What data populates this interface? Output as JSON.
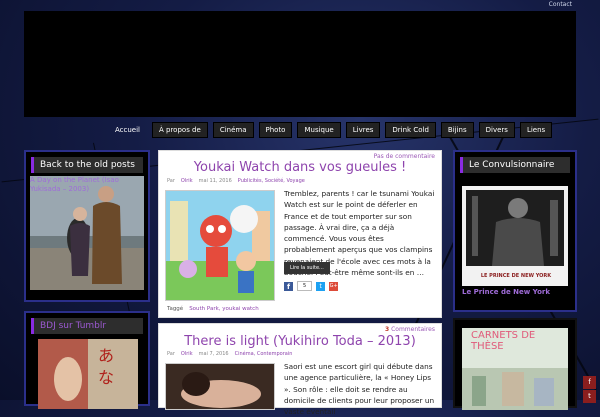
{
  "header": {
    "contact_label": "Contact"
  },
  "nav": [
    {
      "label": "Accueil"
    },
    {
      "label": "À propos de"
    },
    {
      "label": "Cinéma"
    },
    {
      "label": "Photo"
    },
    {
      "label": "Musique"
    },
    {
      "label": "Livres"
    },
    {
      "label": "Drink Cold"
    },
    {
      "label": "Bijins"
    },
    {
      "label": "Divers"
    },
    {
      "label": "Liens"
    }
  ],
  "left_widgets": {
    "old_posts": {
      "title": "Back to the old posts",
      "link": "A Day on the Planet (Isao Yukisada – 2003)"
    },
    "tumblr": {
      "title": "BDJ sur Tumblr"
    }
  },
  "right_widgets": {
    "convulsionnaire": {
      "title": "Le Convulsionnaire",
      "poster_text": "LE PRINCE DE NEW YORK",
      "link": "Le Prince de New York"
    },
    "carnets": {
      "poster_text": "CARNETS DE THÈSE"
    }
  },
  "posts": [
    {
      "comments": "Pas de commentaire",
      "title": "Youkai Watch dans vos gueules !",
      "by": "Par",
      "author": "Olrik",
      "date": "mai 11, 2016",
      "categories": "Publicités, Société, Voyage",
      "body": "Tremblez, parents ! car le tsunami Youkai Watch est sur le point de déferler en France et de tout emporter sur son passage. À vrai dire, ça a déjà commencé. Vous vous êtes probablement aperçus que vos clampins revenaient de l'école avec ces mots à la bouche. Peut-être même sont-ils en …",
      "read_more": "Lire la suite...",
      "fb_count": "5",
      "tags_label": "Taggé",
      "tags": "South Park, youkai watch"
    },
    {
      "comments_count": "3",
      "comments_label": "Commentaires",
      "title": "There is light (Yukihiro Toda – 2013)",
      "by": "Par",
      "author": "Olrik",
      "date": "mai 7, 2016",
      "categories": "Cinéma, Contemporain",
      "body": "Saori est une escort girl qui débute dans une agence particulière, la « Honey Lips ». Son rôle : elle doit se rendre au domicile de clients pour leur proposer un vaste éventail"
    }
  ],
  "colors": {
    "accent": "#8e44ad",
    "nav_bg": "#222222",
    "banner": "#000000"
  },
  "icons": {
    "facebook": "facebook-icon",
    "twitter": "twitter-icon",
    "gplus": "google-plus-icon",
    "side": "share-icon"
  }
}
